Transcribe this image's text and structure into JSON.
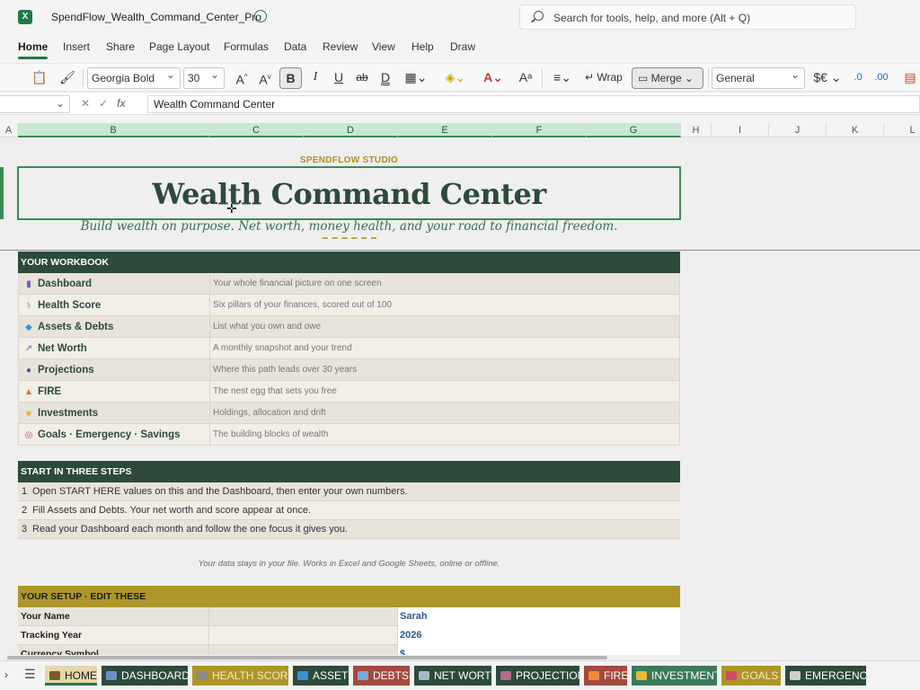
{
  "window": {
    "file_name": "SpendFlow_Wealth_Command_Center_Pro",
    "app_icon": "excel-icon",
    "search_placeholder": "Search for tools, help, and more (Alt + Q)"
  },
  "menu": {
    "tabs": [
      "Home",
      "Insert",
      "Share",
      "Page Layout",
      "Formulas",
      "Data",
      "Review",
      "View",
      "Help",
      "Draw"
    ],
    "active": "Home"
  },
  "ribbon": {
    "font_name": "Georgia Bold",
    "font_size": "30",
    "bold_label": "B",
    "italic_label": "I",
    "underline_label": "U",
    "strike_label": "ab",
    "wrap_label": "Wrap",
    "merge_label": "Merge",
    "number_format": "General",
    "currency_label": "$€"
  },
  "formula_bar": {
    "value": "Wealth Command Center",
    "cancel_glyph": "✕",
    "confirm_glyph": "✓",
    "fx_glyph": "fx"
  },
  "columns": {
    "headers": [
      "A",
      "B",
      "C",
      "D",
      "E",
      "F",
      "G",
      "H",
      "I",
      "J",
      "K",
      "L"
    ],
    "selected": [
      "B",
      "C",
      "D",
      "E",
      "F",
      "G"
    ]
  },
  "sheet": {
    "studio": "SPENDFLOW STUDIO",
    "title": "Wealth Command Center",
    "tagline": "Build wealth on purpose. Net worth, money health, and your road to financial freedom.",
    "workbook": {
      "header": "YOUR WORKBOOK",
      "items": [
        {
          "name": "Dashboard",
          "icon": "chart-icon",
          "icon_color": "#6a5acd",
          "desc": "Your whole financial picture on one screen"
        },
        {
          "name": "Health Score",
          "icon": "stethoscope-icon",
          "icon_color": "#8a8a8a",
          "desc": "Six pillars of your finances, scored out of 100"
        },
        {
          "name": "Assets  &  Debts",
          "icon": "gem-icon",
          "icon_color": "#3d8fd1",
          "desc": "List what you own and owe"
        },
        {
          "name": "Net Worth",
          "icon": "trend-icon",
          "icon_color": "#7a8fa8",
          "desc": "A monthly snapshot and your trend"
        },
        {
          "name": "Projections",
          "icon": "crystal-ball-icon",
          "icon_color": "#6a4a8a",
          "desc": "Where this path leads over 30 years"
        },
        {
          "name": "FIRE",
          "icon": "fire-icon",
          "icon_color": "#e06a2a",
          "desc": "The nest egg that sets you free"
        },
        {
          "name": "Investments",
          "icon": "folder-icon",
          "icon_color": "#e8b83a",
          "desc": "Holdings, allocation and drift"
        },
        {
          "name": "Goals  ·  Emergency  ·  Savings",
          "icon": "target-icon",
          "icon_color": "#d14a6a",
          "desc": "The building blocks of wealth"
        }
      ]
    },
    "steps": {
      "header": "START IN THREE STEPS",
      "items": [
        {
          "num": "1",
          "text": "Open START HERE values on this and the Dashboard, then enter your own numbers."
        },
        {
          "num": "2",
          "text": "Fill Assets and Debts. Your net worth and score appear at once."
        },
        {
          "num": "3",
          "text": "Read your Dashboard each month and follow the one focus it gives you."
        }
      ]
    },
    "privacy_note": "Your data stays in your file. Works in Excel and Google Sheets, online or offline.",
    "setup": {
      "header": "YOUR SETUP  ·  EDIT THESE",
      "rows": [
        {
          "label": "Your Name",
          "value": "Sarah"
        },
        {
          "label": "Tracking Year",
          "value": "2026"
        },
        {
          "label": "Currency Symbol",
          "value": "$"
        }
      ]
    }
  },
  "sheet_tabs": {
    "active": "HOME",
    "tabs": [
      {
        "label": "HOME",
        "icon": "home-icon",
        "bg": "#e4d8a8",
        "fg": "#1b1b1b",
        "icon_color": "#7a5a2a"
      },
      {
        "label": "DASHBOARD",
        "icon": "chart-icon",
        "bg": "#2d4a3b",
        "fg": "#ffffff",
        "icon_color": "#6a8fc8"
      },
      {
        "label": "HEALTH SCORE",
        "icon": "stethoscope-icon",
        "bg": "#ad9528",
        "fg": "#f4ecc0",
        "icon_color": "#8a8a8a"
      },
      {
        "label": "ASSETS",
        "icon": "gem-icon",
        "bg": "#2d4a3b",
        "fg": "#ffffff",
        "icon_color": "#3d8fd1"
      },
      {
        "label": "DEBTS",
        "icon": "card-icon",
        "bg": "#a44a3f",
        "fg": "#ffffff",
        "icon_color": "#7aa8d8"
      },
      {
        "label": "NET WORTH",
        "icon": "trend-icon",
        "bg": "#2d4a3b",
        "fg": "#ffffff",
        "icon_color": "#a8b8c8"
      },
      {
        "label": "PROJECTIONS",
        "icon": "crystal-ball-icon",
        "bg": "#2d4a3b",
        "fg": "#ffffff",
        "icon_color": "#b86a8a"
      },
      {
        "label": "FIRE",
        "icon": "fire-icon",
        "bg": "#a44a3f",
        "fg": "#ffffff",
        "icon_color": "#f08a3a"
      },
      {
        "label": "INVESTMENTS",
        "icon": "folder-icon",
        "bg": "#3a7a5a",
        "fg": "#ffffff",
        "icon_color": "#e8b83a"
      },
      {
        "label": "GOALS",
        "icon": "target-icon",
        "bg": "#ad9528",
        "fg": "#f4ecc0",
        "icon_color": "#d14a6a"
      },
      {
        "label": "EMERGENCY",
        "icon": "shield-icon",
        "bg": "#2d4a3b",
        "fg": "#ffffff",
        "icon_color": "#cfcfcf"
      }
    ]
  }
}
